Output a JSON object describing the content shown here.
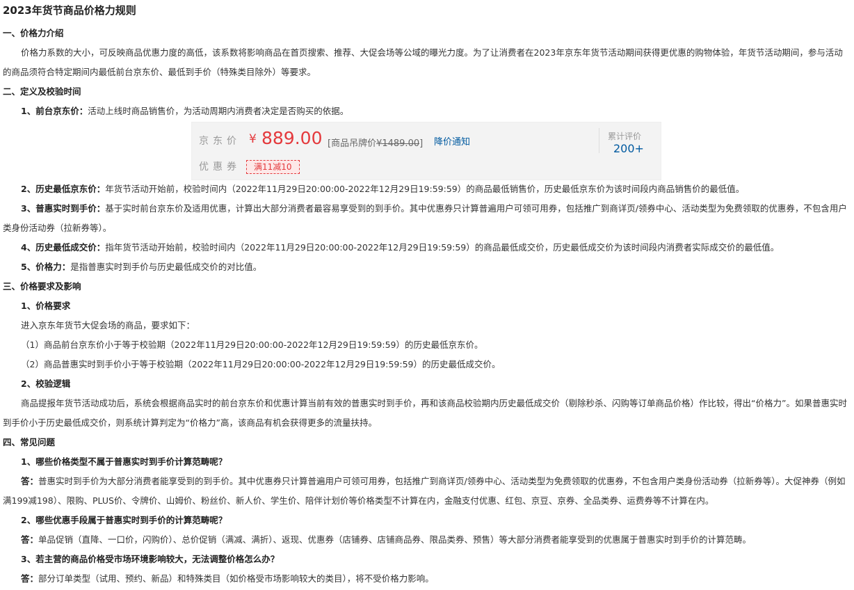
{
  "doc": {
    "title": "2023年货节商品价格力规则",
    "s1_head": "一、价格力介绍",
    "s1_p": "价格力系数的大小，可反映商品优惠力度的高低，该系数将影响商品在首页搜索、推荐、大促会场等公域的曝光力度。为了让消费者在2023年京东年货节活动期间获得更优惠的购物体验，年货节活动期间，参与活动的商品须符合特定期间内最低前台京东价、最低到手价（特殊类目除外）等要求。",
    "s2_head": "二、定义及校验时间",
    "d1_label": "1、前台京东价：",
    "d1_text": "活动上线时商品销售价，为活动周期内消费者决定是否购买的依据。",
    "d2_label": "2、历史最低京东价：",
    "d2_text": "年货节活动开始前，校验时间内（2022年11月29日20:00:00-2022年12月29日19:59:59）的商品最低销售价，历史最低京东价为该时间段内商品销售价的最低值。",
    "d3_label": "3、普惠实时到手价：",
    "d3_text": "基于实时前台京东价及适用优惠，计算出大部分消费者最容易享受到的到手价。其中优惠券只计算普遍用户可领可用券，包括推广到商详页/领券中心、活动类型为免费领取的优惠券，不包含用户类身份活动券（拉新券等）。",
    "d4_label": "4、历史最低成交价：",
    "d4_text": "指年货节活动开始前，校验时间内（2022年11月29日20:00:00-2022年12月29日19:59:59）的商品最低成交价，历史最低成交价为该时间段内消费者实际成交价的最低值。",
    "d5_label": "5、价格力：",
    "d5_text": "是指普惠实时到手价与历史最低成交价的对比值。",
    "s3_head": "三、价格要求及影响",
    "s3_1_head": "1、价格要求",
    "s3_1_intro": "进入京东年货节大促会场的商品，要求如下：",
    "s3_1_r1": "（1）商品前台京东价小于等于校验期（2022年11月29日20:00:00-2022年12月29日19:59:59）的历史最低京东价。",
    "s3_1_r2": "（2）商品普惠实时到手价小于等于校验期（2022年11月29日20:00:00-2022年12月29日19:59:59）的历史最低成交价。",
    "s3_2_head": "2、校验逻辑",
    "s3_2_p": "商品提报年货节活动成功后，系统会根据商品实时的前台京东价和优惠计算当前有效的普惠实时到手价，再和该商品校验期内历史最低成交价（剔除秒杀、闪购等订单商品价格）作比较，得出“价格力”。如果普惠实时到手价小于历史最低成交价，则系统计算判定为“价格力”高，该商品有机会获得更多的流量扶持。",
    "s4_head": "四、常见问题",
    "q1": "1、哪些价格类型不属于普惠实时到手价计算范畴呢？",
    "a_label": "答：",
    "a1": "普惠实时到手价为大部分消费者能享受到的到手价。其中优惠券只计算普遍用户可领可用券，包括推广到商详页/领券中心、活动类型为免费领取的优惠券，不包含用户类身份活动券（拉新券等）。大促神券（例如满199减198）、限购、PLUS价、令牌价、山姆价、粉丝价、新人价、学生价、陪伴计划价等价格类型不计算在内，金融支付优惠、红包、京豆、京券、全品类券、运费券等不计算在内。",
    "q2": "2、哪些优惠手段属于普惠实时到手价的计算范畴呢？",
    "a2": "单品促销（直降、一口价，闪购价）、总价促销（满减、满折）、返现、优惠券（店铺券、店铺商品券、限品类券、预售）等大部分消费者能享受到的优惠属于普惠实时到手价的计算范畴。",
    "q3": "3、若主营的商品价格受市场环境影响较大，无法调整价格怎么办？",
    "a3": "部分订单类型（试用、预约、新品）和特殊类目（如价格受市场影响较大的类目），将不受价格力影响。"
  },
  "pricebox": {
    "jd_price_label": "京东价",
    "currency": "¥",
    "price": "889.00",
    "list_prefix": "[商品吊牌价",
    "list_price": "¥1489.00",
    "list_suffix": "]",
    "notify_link": "降价通知",
    "review_label": "累计评价",
    "review_count": "200+",
    "coupon_label": "优惠券",
    "coupon_tag": "满11减10"
  },
  "colors": {
    "price_red": "#e4393c",
    "link_blue": "#005aa0"
  }
}
